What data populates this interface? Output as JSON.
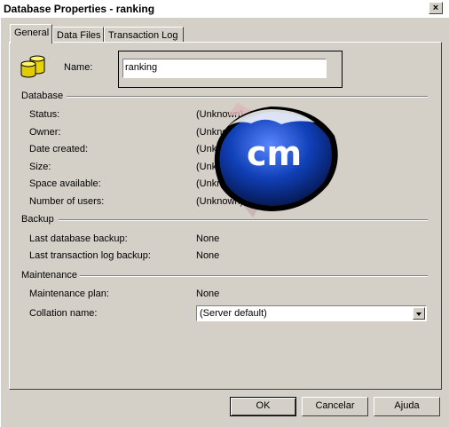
{
  "window": {
    "title": "Database Properties - ranking",
    "close_label": "×"
  },
  "tabs": [
    {
      "label": "General"
    },
    {
      "label": "Data Files"
    },
    {
      "label": "Transaction Log"
    }
  ],
  "general": {
    "name_label": "Name:",
    "name_value": "ranking",
    "database": {
      "header": "Database",
      "rows": [
        {
          "label": "Status:",
          "value": "(Unknown)"
        },
        {
          "label": "Owner:",
          "value": "(Unknown)"
        },
        {
          "label": "Date created:",
          "value": "(Unknown)"
        },
        {
          "label": "Size:",
          "value": "(Unknown)"
        },
        {
          "label": "Space available:",
          "value": "(Unknown)"
        },
        {
          "label": "Number of users:",
          "value": "(Unknown)"
        }
      ]
    },
    "backup": {
      "header": "Backup",
      "rows": [
        {
          "label": "Last database backup:",
          "value": "None"
        },
        {
          "label": "Last transaction log backup:",
          "value": "None"
        }
      ]
    },
    "maintenance": {
      "header": "Maintenance",
      "plan_label": "Maintenance plan:",
      "plan_value": "None",
      "collation_label": "Collation name:",
      "collation_value": "(Server default)"
    }
  },
  "watermark": {
    "text": "cm"
  },
  "buttons": {
    "ok": "OK",
    "cancel": "Cancelar",
    "help": "Ajuda"
  },
  "icons": {
    "database": "database-cylinders-icon",
    "close": "close-icon",
    "dropdown": "chevron-down-icon"
  },
  "colors": {
    "dialog_bg": "#d4d0c8",
    "watermark_blue": "#1040b8"
  }
}
